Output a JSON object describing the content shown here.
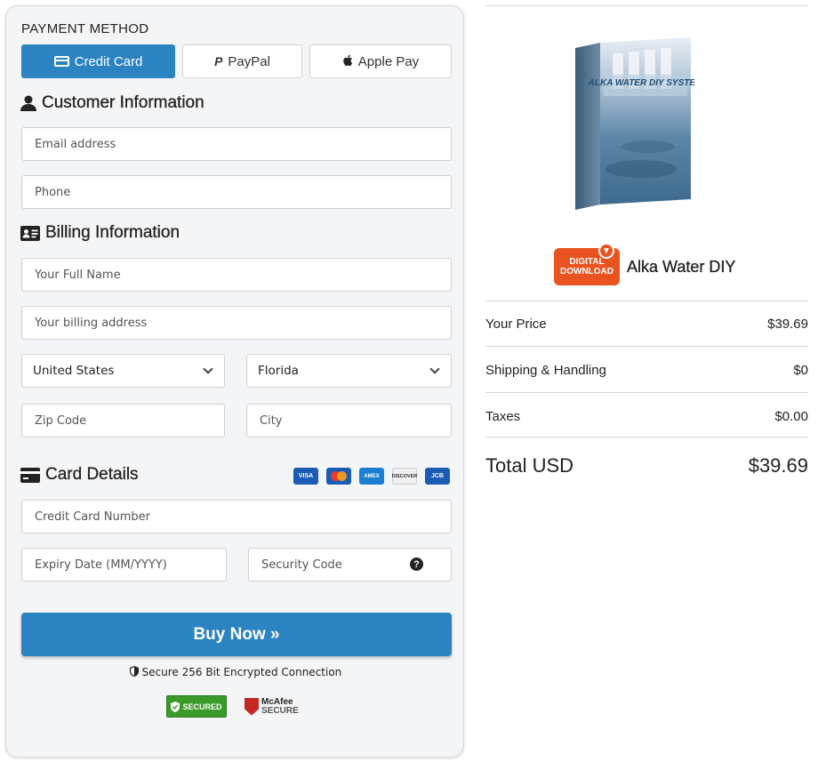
{
  "payment_method": {
    "title": "PAYMENT METHOD",
    "tabs": [
      {
        "label": "Credit Card",
        "icon": "credit-card-icon",
        "active": true
      },
      {
        "label": "PayPal",
        "icon": "paypal-icon",
        "active": false
      },
      {
        "label": "Apple Pay",
        "icon": "apple-icon",
        "active": false
      }
    ]
  },
  "customer": {
    "heading": "Customer Information",
    "email_placeholder": "Email address",
    "phone_placeholder": "Phone"
  },
  "billing": {
    "heading": "Billing Information",
    "name_placeholder": "Your Full Name",
    "address_placeholder": "Your billing address",
    "country": "United States",
    "state": "Florida",
    "zip_placeholder": "Zip Code",
    "city_placeholder": "City"
  },
  "card": {
    "heading": "Card Details",
    "logos": [
      "VISA",
      "MasterCard",
      "AMEX",
      "DISCOVER",
      "JCB"
    ],
    "number_placeholder": "Credit Card Number",
    "expiry_placeholder": "Expiry Date (MM/YYYY)",
    "cvv_placeholder": "Security Code"
  },
  "buy_button": "Buy Now »",
  "secure_text": "Secure 256 Bit Encrypted Connection",
  "badges": {
    "trustguard": "SECURED",
    "mcafee_line1": "McAfee",
    "mcafee_line2": "SECURE"
  },
  "product": {
    "name": "Alka Water DIY",
    "book_title": "ALKA WATER DIY SYSTEM",
    "download_badge_line1": "DIGITAL",
    "download_badge_line2": "DOWNLOAD"
  },
  "summary": {
    "rows": [
      {
        "label": "Your Price",
        "value": "$39.69"
      },
      {
        "label": "Shipping & Handling",
        "value": "$0"
      },
      {
        "label": "Taxes",
        "value": "$0.00"
      }
    ],
    "total_label": "Total USD",
    "total_value": "$39.69"
  },
  "colors": {
    "accent": "#2b83c1",
    "panel_bg": "#f4f5f7",
    "download_badge": "#e8531f"
  }
}
